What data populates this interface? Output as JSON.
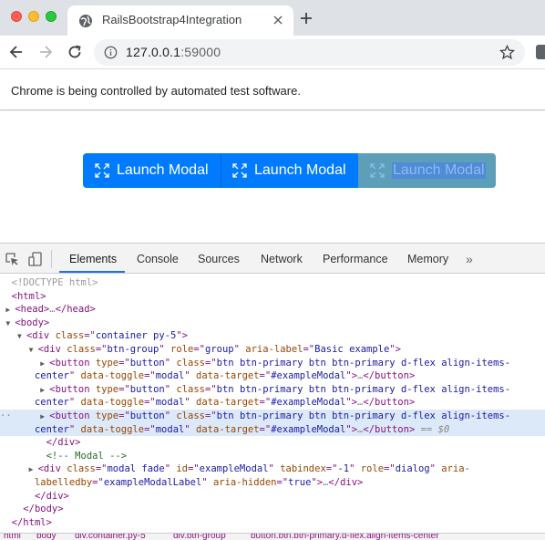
{
  "browser": {
    "tab_title": "RailsBootstrap4Integration",
    "url_host": "127.0.0.1",
    "url_port": ":59000",
    "infobar_text": "Chrome is being controlled by automated test software."
  },
  "page": {
    "buttons": [
      {
        "label": "Launch Modal"
      },
      {
        "label": "Launch Modal"
      },
      {
        "label": "Launch Modal"
      }
    ]
  },
  "devtools": {
    "tabs": [
      "Elements",
      "Console",
      "Sources",
      "Network",
      "Performance",
      "Memory"
    ],
    "more": "»",
    "selected_marker": "== $0",
    "breadcrumb": [
      "html",
      "body",
      "div.container.py-5",
      "div.btn-group",
      "button.btn.btn-primary.d-flex.align-items-center"
    ]
  },
  "colors": {
    "primary": "#007bff",
    "devtools_tab_active": "#1a73e8",
    "selected_row": "#dce9f8"
  }
}
